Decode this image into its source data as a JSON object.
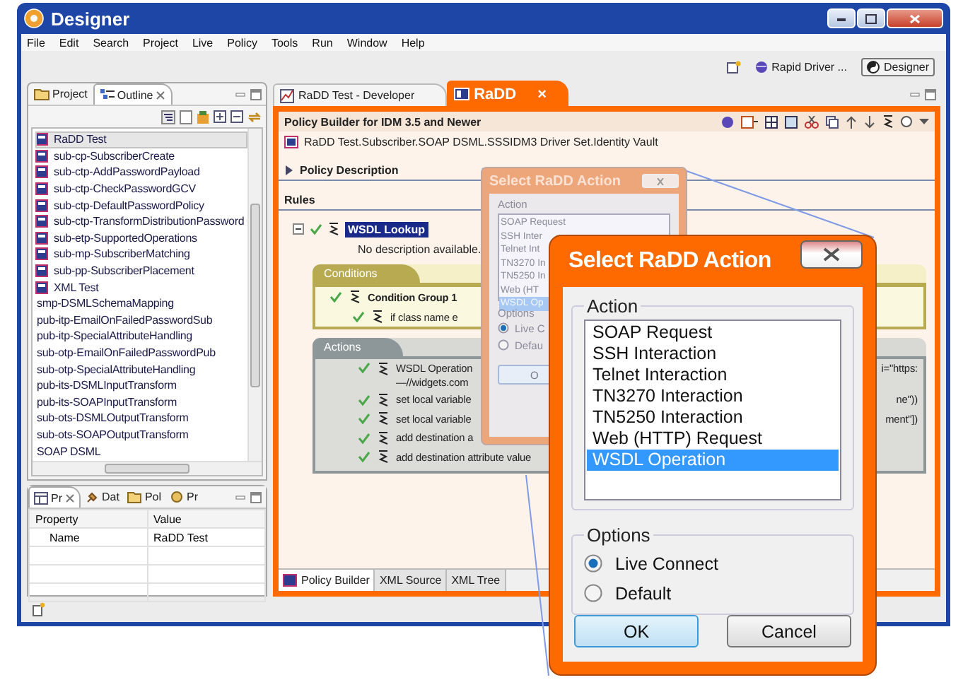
{
  "window": {
    "title": "Designer"
  },
  "menu": [
    "File",
    "Edit",
    "Search",
    "Project",
    "Live",
    "Policy",
    "Tools",
    "Run",
    "Window",
    "Help"
  ],
  "perspectives": [
    {
      "label": "Rapid Driver ...",
      "selected": false
    },
    {
      "label": "Designer",
      "selected": true
    }
  ],
  "left_tabs": [
    {
      "label": "Project",
      "selected": false
    },
    {
      "label": "Outline",
      "selected": true
    }
  ],
  "outline_items": [
    {
      "label": "RaDD Test",
      "kind": "policy",
      "selected": true
    },
    {
      "label": "sub-cp-SubscriberCreate",
      "kind": "policy",
      "selected": false
    },
    {
      "label": "sub-ctp-AddPasswordPayload",
      "kind": "policy",
      "selected": false
    },
    {
      "label": "sub-ctp-CheckPasswordGCV",
      "kind": "policy",
      "selected": false
    },
    {
      "label": "sub-ctp-DefaultPasswordPolicy",
      "kind": "policy",
      "selected": false
    },
    {
      "label": "sub-ctp-TransformDistributionPassword",
      "kind": "policy",
      "selected": false
    },
    {
      "label": "sub-etp-SupportedOperations",
      "kind": "policy",
      "selected": false
    },
    {
      "label": "sub-mp-SubscriberMatching",
      "kind": "policy",
      "selected": false
    },
    {
      "label": "sub-pp-SubscriberPlacement",
      "kind": "policy",
      "selected": false
    },
    {
      "label": "XML Test",
      "kind": "policy",
      "selected": false
    },
    {
      "label": "smp-DSMLSchemaMapping",
      "kind": "plain",
      "selected": false
    },
    {
      "label": "pub-itp-EmailOnFailedPasswordSub",
      "kind": "plain",
      "selected": false
    },
    {
      "label": "pub-itp-SpecialAttributeHandling",
      "kind": "plain",
      "selected": false
    },
    {
      "label": "sub-otp-EmailOnFailedPasswordPub",
      "kind": "plain",
      "selected": false
    },
    {
      "label": "sub-otp-SpecialAttributeHandling",
      "kind": "plain",
      "selected": false
    },
    {
      "label": "pub-its-DSMLInputTransform",
      "kind": "plain",
      "selected": false
    },
    {
      "label": "pub-its-SOAPInputTransform",
      "kind": "plain",
      "selected": false
    },
    {
      "label": "sub-ots-DSMLOutputTransform",
      "kind": "plain",
      "selected": false
    },
    {
      "label": "sub-ots-SOAPOutputTransform",
      "kind": "plain",
      "selected": false
    },
    {
      "label": "SOAP DSML",
      "kind": "plain",
      "selected": false
    }
  ],
  "properties_tabs": [
    {
      "label": "Pr",
      "selected": true
    },
    {
      "label": "Dat",
      "selected": false
    },
    {
      "label": "Pol",
      "selected": false
    },
    {
      "label": "Pr",
      "selected": false
    }
  ],
  "properties": {
    "columns": [
      "Property",
      "Value"
    ],
    "rows": [
      [
        "Name",
        "RaDD Test"
      ]
    ]
  },
  "editor_tabs": [
    {
      "label": "RaDD Test - Developer",
      "selected": false
    },
    {
      "label": "RaDD",
      "selected": true,
      "close": "×"
    }
  ],
  "editor": {
    "title": "Policy Builder for IDM 3.5 and Newer",
    "path": "RaDD Test.Subscriber.SOAP DSML.SSSIDM3 Driver Set.Identity Vault",
    "policy_description": "Policy Description",
    "expanded": false,
    "rules_label": "Rules",
    "rule": {
      "name": "WSDL Lookup",
      "description": "No description available."
    },
    "conditions": {
      "label": "Conditions",
      "group": "Condition Group 1",
      "items": [
        "if class name e"
      ]
    },
    "actions": {
      "label": "Actions",
      "items": [
        {
          "text": "WSDL Operation",
          "detail": "—//widgets.com",
          "tail": "i=\"https:"
        },
        {
          "text": "set local variable",
          "tail": "ne\"))"
        },
        {
          "text": "set local variable",
          "tail": "ment\"])"
        },
        {
          "text": "add destination a"
        },
        {
          "text": "add destination attribute value"
        }
      ]
    }
  },
  "bottom_tabs": [
    {
      "label": "Policy Builder",
      "selected": true
    },
    {
      "label": "XML Source",
      "selected": false
    },
    {
      "label": "XML Tree",
      "selected": false
    }
  ],
  "ghost_dialog": {
    "title": "Select RaDD Action",
    "action_label": "Action",
    "actions": [
      {
        "label": "SOAP Request",
        "selected": false
      },
      {
        "label": "SSH Inter",
        "selected": false
      },
      {
        "label": "Telnet Int",
        "selected": false
      },
      {
        "label": "TN3270 In",
        "selected": false
      },
      {
        "label": "TN5250 In",
        "selected": false
      },
      {
        "label": "Web (HT",
        "selected": false
      },
      {
        "label": "WSDL Op",
        "selected": true
      }
    ],
    "options_label": "Options",
    "options": [
      {
        "label": "Live C",
        "selected": true
      },
      {
        "label": "Defau",
        "selected": false
      }
    ],
    "button": "O"
  },
  "dialog": {
    "title": "Select RaDD Action",
    "action_label": "Action",
    "actions": [
      {
        "label": "SOAP Request",
        "selected": false
      },
      {
        "label": "SSH Interaction",
        "selected": false
      },
      {
        "label": "Telnet Interaction",
        "selected": false
      },
      {
        "label": "TN3270 Interaction",
        "selected": false
      },
      {
        "label": "TN5250 Interaction",
        "selected": false
      },
      {
        "label": "Web (HTTP) Request",
        "selected": false
      },
      {
        "label": "WSDL Operation",
        "selected": true
      }
    ],
    "options_label": "Options",
    "options": [
      {
        "label": "Live Connect",
        "selected": true
      },
      {
        "label": "Default",
        "selected": false
      }
    ],
    "buttons": [
      {
        "label": "OK",
        "kind": "default"
      },
      {
        "label": "Cancel",
        "kind": "normal"
      }
    ]
  }
}
